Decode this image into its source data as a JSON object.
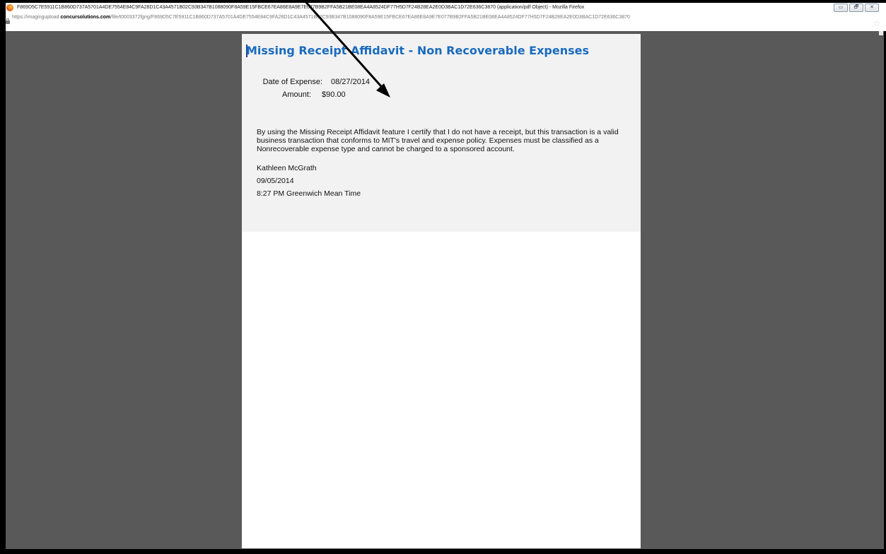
{
  "window": {
    "title": "F869D5C7E5911C1B860D737A5701A4DE7554E84C9FA28D1C43A4571B02C93B347B1088090F8A59E15FBCE67EA86E8A9E7E077B9B2FFA5B21BE08EA4A8524DF77H5D7F24B28EA2E0D3BAC1D72E636C3870 (application/pdf Object) - Mozilla Firefox",
    "controls": {
      "minimize": "▭",
      "restore": "🗗",
      "close": "✕"
    }
  },
  "address_bar": {
    "url_prefix": "https://imagingupload.",
    "url_domain": "concursolutions.com",
    "url_path": "/file/t0003372fgng/F869D5C7E5911C1B860D737A5701A4DE7554E84C9FA28D1C43A4571B02C93B347B1088090F8A59E15FBCE67EA86E8A9E7E077B9B2FFA5B21BE08EA4A8524DF77H5D7F24B28EA2E0D3BAC1D72E636C3870"
  },
  "document": {
    "title": "Missing Receipt Affidavit - Non Recoverable Expenses",
    "fields": [
      {
        "label": "Date of Expense:",
        "value": "08/27/2014"
      },
      {
        "label": "Amount:",
        "value": "$90.00"
      }
    ],
    "statement": "By using the Missing Receipt Affidavit feature I certify that I do not have a receipt, but this transaction is a valid business transaction that conforms to MIT's travel and expense policy. Expenses must be classified as a Nonrecoverable expense type and cannot be charged to a sponsored account.",
    "signer": "Kathleen McGrath",
    "signed_date": "09/05/2014",
    "signed_time": "8:27 PM Greenwich Mean Time"
  },
  "colors": {
    "title_blue": "#1a6bbd",
    "viewer_background": "#595959",
    "panel_background": "#f2f2f2"
  },
  "icons": {
    "browser": "firefox-icon",
    "secure": "lock-icon",
    "bookmark": "star-icon"
  }
}
